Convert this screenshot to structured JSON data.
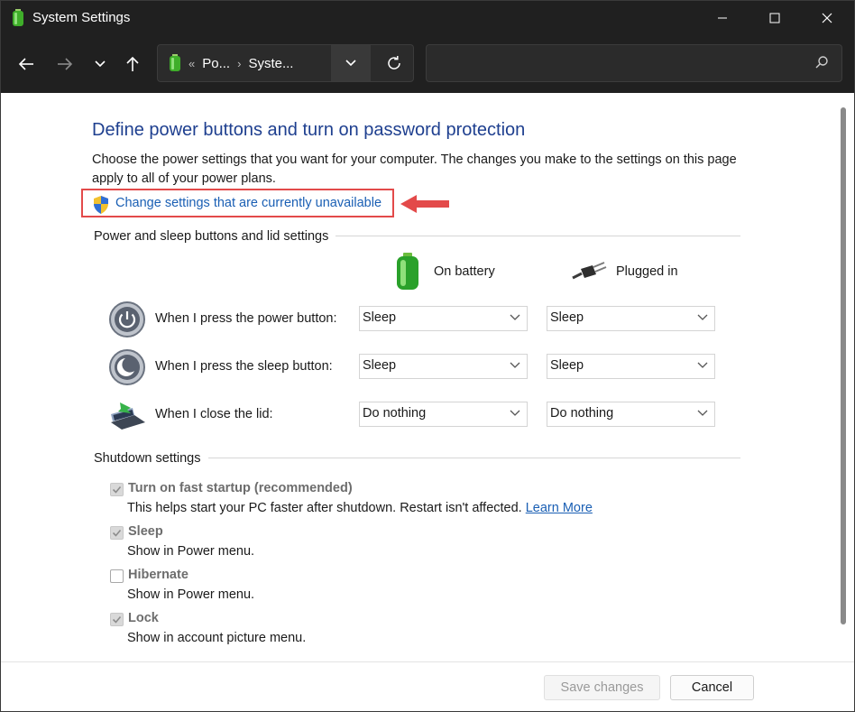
{
  "window": {
    "title": "System Settings"
  },
  "address": {
    "crumb_1": "Po...",
    "crumb_2": "Syste...",
    "overflow": "«",
    "separator": "›"
  },
  "search": {
    "placeholder": ""
  },
  "main": {
    "heading": "Define power buttons and turn on password protection",
    "description": "Choose the power settings that you want for your computer. The changes you make to the settings on this page apply to all of your power plans.",
    "change_link": "Change settings that are currently unavailable"
  },
  "power_group": {
    "label": "Power and sleep buttons and lid settings",
    "col_battery": "On battery",
    "col_plugged": "Plugged in",
    "rows": [
      {
        "label": "When I press the power button:",
        "battery": "Sleep",
        "plugged": "Sleep"
      },
      {
        "label": "When I press the sleep button:",
        "battery": "Sleep",
        "plugged": "Sleep"
      },
      {
        "label": "When I close the lid:",
        "battery": "Do nothing",
        "plugged": "Do nothing"
      }
    ]
  },
  "shutdown_group": {
    "label": "Shutdown settings",
    "items": [
      {
        "label": "Turn on fast startup (recommended)",
        "desc": "This helps start your PC faster after shutdown. Restart isn't affected.",
        "link": "Learn More",
        "checked": true
      },
      {
        "label": "Sleep",
        "desc": "Show in Power menu.",
        "checked": true
      },
      {
        "label": "Hibernate",
        "desc": "Show in Power menu.",
        "checked": false
      },
      {
        "label": "Lock",
        "desc": "Show in account picture menu.",
        "checked": true
      }
    ]
  },
  "footer": {
    "save_label": "Save changes",
    "cancel_label": "Cancel"
  },
  "colors": {
    "heading": "#1e3f8f",
    "link": "#1a5fb4",
    "highlight": "#e34a4a",
    "titlebar": "#202020"
  }
}
